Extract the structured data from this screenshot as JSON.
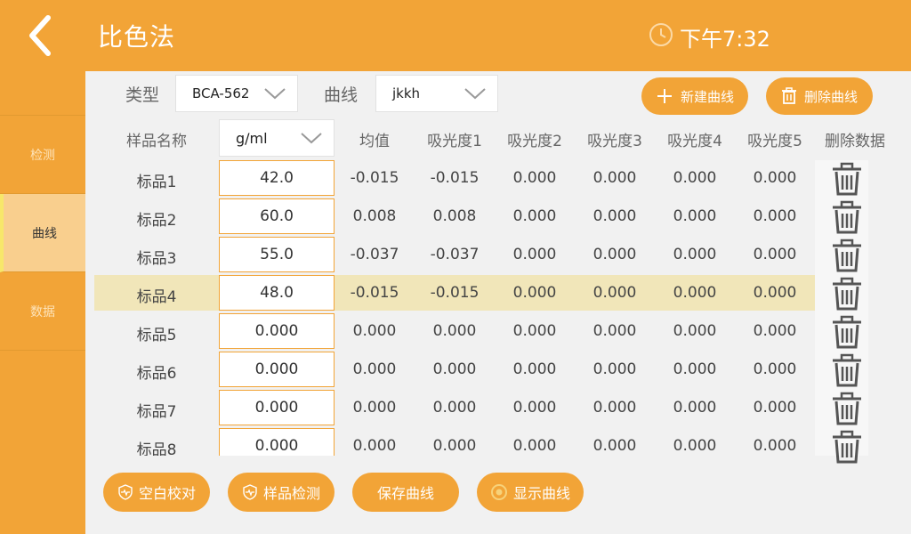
{
  "header": {
    "title": "比色法",
    "time": "下午7:32"
  },
  "sidebar": {
    "items": [
      {
        "label": "检测"
      },
      {
        "label": "曲线"
      },
      {
        "label": "数据"
      }
    ]
  },
  "controls": {
    "type_label": "类型",
    "type_value": "BCA-562",
    "curve_label": "曲线",
    "curve_value": "jkkh",
    "new_curve": "新建曲线",
    "delete_curve": "删除曲线"
  },
  "table": {
    "headers": {
      "name": "样品名称",
      "unit": "g/ml",
      "mean": "均值",
      "abs1": "吸光度1",
      "abs2": "吸光度2",
      "abs3": "吸光度3",
      "abs4": "吸光度4",
      "abs5": "吸光度5",
      "delete": "删除数据"
    },
    "rows": [
      {
        "name": "标品1",
        "conc": "42.0",
        "mean": "-0.015",
        "a1": "-0.015",
        "a2": "0.000",
        "a3": "0.000",
        "a4": "0.000",
        "a5": "0.000"
      },
      {
        "name": "标品2",
        "conc": "60.0",
        "mean": "0.008",
        "a1": "0.008",
        "a2": "0.000",
        "a3": "0.000",
        "a4": "0.000",
        "a5": "0.000"
      },
      {
        "name": "标品3",
        "conc": "55.0",
        "mean": "-0.037",
        "a1": "-0.037",
        "a2": "0.000",
        "a3": "0.000",
        "a4": "0.000",
        "a5": "0.000"
      },
      {
        "name": "标品4",
        "conc": "48.0",
        "mean": "-0.015",
        "a1": "-0.015",
        "a2": "0.000",
        "a3": "0.000",
        "a4": "0.000",
        "a5": "0.000"
      },
      {
        "name": "标品5",
        "conc": "0.000",
        "mean": "0.000",
        "a1": "0.000",
        "a2": "0.000",
        "a3": "0.000",
        "a4": "0.000",
        "a5": "0.000"
      },
      {
        "name": "标品6",
        "conc": "0.000",
        "mean": "0.000",
        "a1": "0.000",
        "a2": "0.000",
        "a3": "0.000",
        "a4": "0.000",
        "a5": "0.000"
      },
      {
        "name": "标品7",
        "conc": "0.000",
        "mean": "0.000",
        "a1": "0.000",
        "a2": "0.000",
        "a3": "0.000",
        "a4": "0.000",
        "a5": "0.000"
      },
      {
        "name": "标品8",
        "conc": "0.000",
        "mean": "0.000",
        "a1": "0.000",
        "a2": "0.000",
        "a3": "0.000",
        "a4": "0.000",
        "a5": "0.000"
      }
    ]
  },
  "bottom": {
    "blank": "空白校对",
    "sample": "样品检测",
    "save": "保存曲线",
    "show": "显示曲线"
  },
  "colors": {
    "accent": "#f2a437",
    "highlight_row": "#f1e6b9",
    "active_tab": "#f9cf8e"
  },
  "icons": [
    "back-arrow-icon",
    "clock-icon",
    "chevron-down-icon",
    "plus-icon",
    "trash-icon",
    "shield-pulse-icon",
    "target-icon"
  ]
}
